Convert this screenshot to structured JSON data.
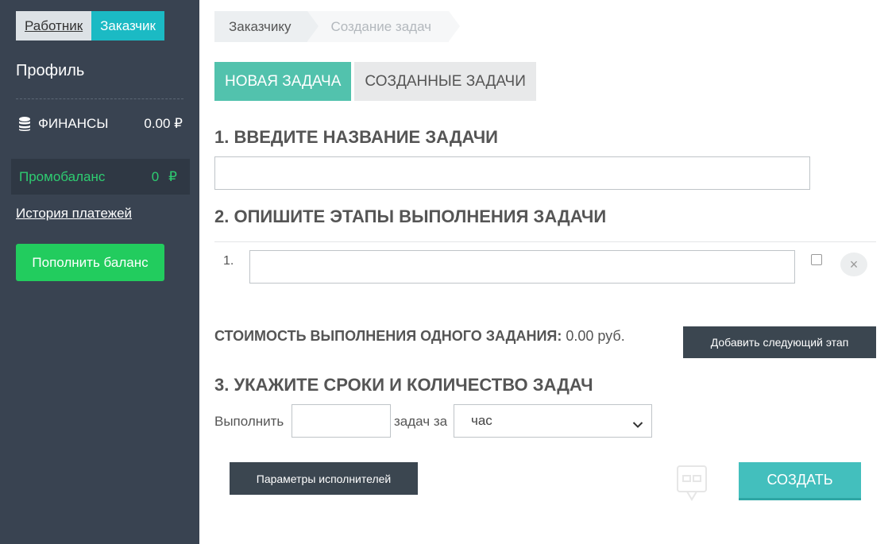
{
  "sidebar": {
    "role_worker": "Работник",
    "role_customer": "Заказчик",
    "profile": "Профиль",
    "finance_label": "ФИНАНСЫ",
    "finance_value": "0.00 ₽",
    "promo_label": "Промобаланс",
    "promo_value": "0",
    "promo_currency": "₽",
    "history_link": "История платежей",
    "topup_button": "Пополнить баланс",
    "finance_icon": "coins-icon"
  },
  "breadcrumb": {
    "items": [
      "Заказчику",
      "Создание задач"
    ]
  },
  "tabs": {
    "new": "НОВАЯ ЗАДАЧА",
    "created": "СОЗДАННЫЕ ЗАДАЧИ"
  },
  "form": {
    "title1": "1. ВВЕДИТЕ НАЗВАНИЕ ЗАДАЧИ",
    "title2": "2. ОПИШИТЕ ЭТАПЫ ВЫПОЛНЕНИЯ ЗАДАЧИ",
    "stage_number": "1.",
    "stage_remove": "×",
    "cost_label": "СТОИМОСТЬ ВЫПОЛНЕНИЯ ОДНОГО ЗАДАНИЯ:",
    "cost_value": "0.00 руб.",
    "add_stage_button": "Добавить следующий этап",
    "title3": "3. УКАЖИТЕ СРОКИ И КОЛИЧЕСТВО ЗАДАЧ",
    "execute_label": "Выполнить",
    "per_label": "задач за",
    "period_value": "час",
    "params_button": "Параметры исполнителей",
    "create_button": "СОЗДАТЬ"
  },
  "colors": {
    "sidebar_bg": "#394351",
    "accent_teal": "#52c2ad",
    "customer_active": "#1bbac4",
    "promo_green": "#2ecc71",
    "topup_green": "#22cc5e",
    "dark_button": "#3b4650",
    "create_button": "#43bfbd"
  }
}
